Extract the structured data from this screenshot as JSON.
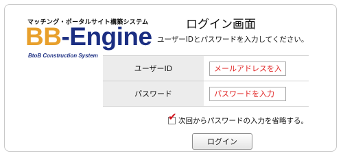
{
  "logo": {
    "tagline": "マッチング・ポータルサイト構築システム",
    "name_highlight": "BB",
    "name_rest": "-Engine",
    "sub": "BtoB Construction System",
    "colors": {
      "highlight": "#e8a02c",
      "main": "#1b2e82"
    }
  },
  "page": {
    "title": "ログイン画面",
    "subtitle": "ユーザーIDとパスワードを入力してください。"
  },
  "form": {
    "user_id": {
      "label": "ユーザーID",
      "placeholder": "メールアドレスを入力",
      "value": ""
    },
    "password": {
      "label": "パスワード",
      "placeholder": "パスワードを入力",
      "value": ""
    },
    "remember": {
      "label": "次回からパスワードの入力を省略する。",
      "checked": true,
      "check_glyph": "✔"
    },
    "submit_label": "ログイン",
    "colors": {
      "placeholder": "#e02020",
      "label_bg": "#ececec",
      "check": "#d0141d"
    }
  }
}
